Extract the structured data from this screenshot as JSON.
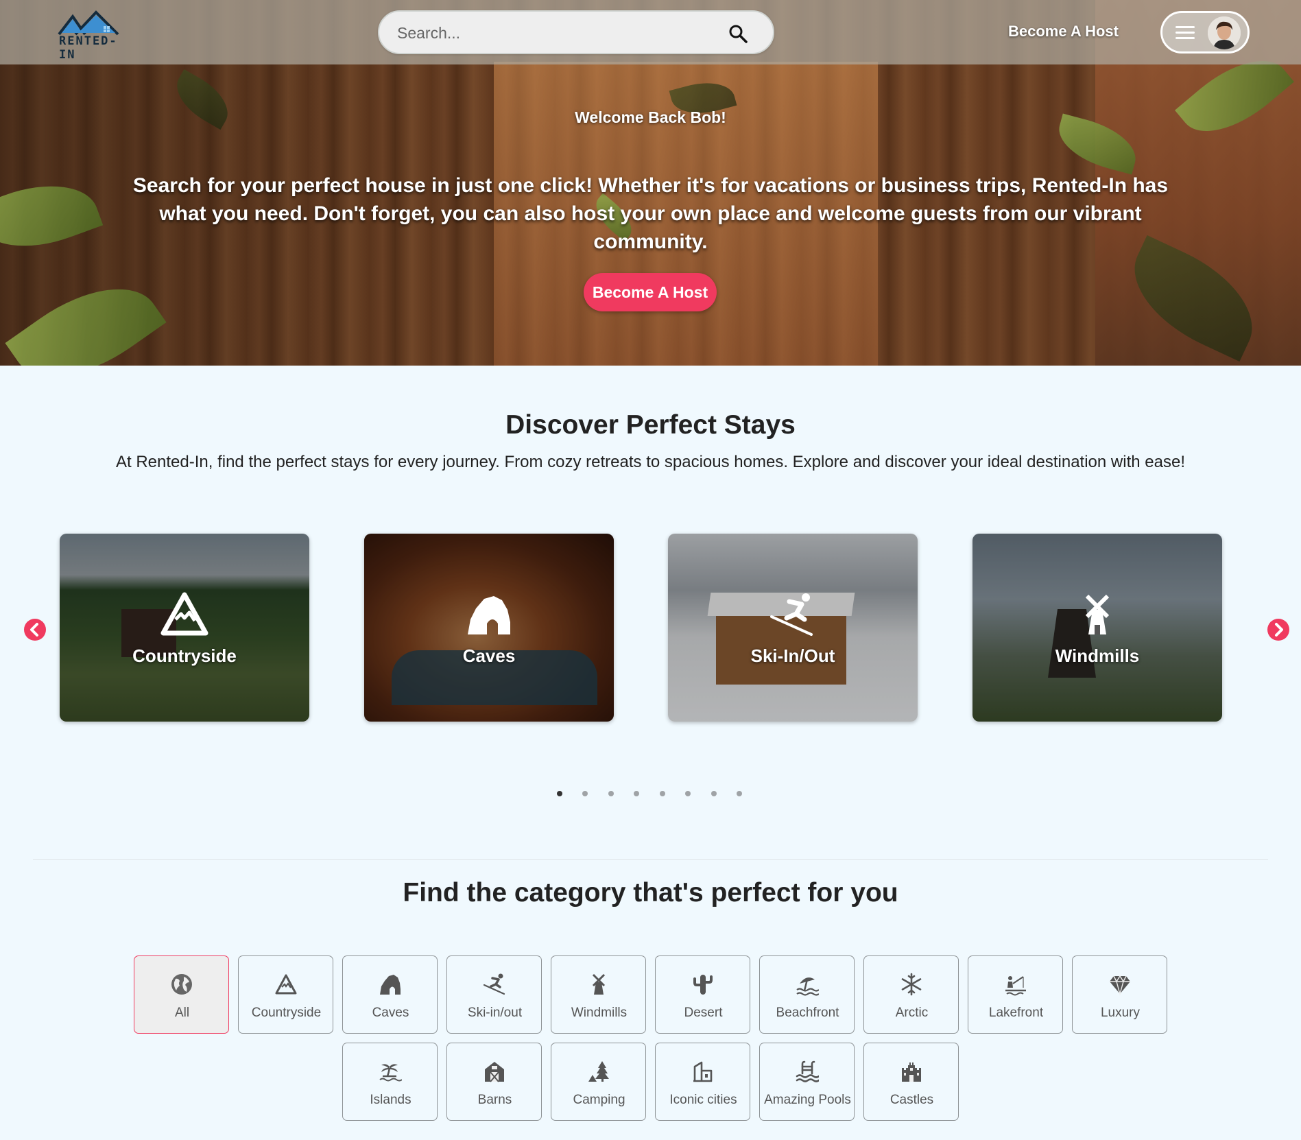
{
  "brand": {
    "logo_text": "RENTED-IN"
  },
  "header": {
    "search_placeholder": "Search...",
    "become_host_label": "Become A Host"
  },
  "hero": {
    "welcome": "Welcome Back Bob!",
    "tagline": "Search for your perfect house in just one click! Whether it's for vacations or business trips, Rented-In has what you need. Don't forget, you can also host your own place and welcome guests from our vibrant community.",
    "cta_label": "Become A Host"
  },
  "discover": {
    "title": "Discover Perfect Stays",
    "subtitle": "At Rented-In, find the perfect stays for every journey. From cozy retreats to spacious homes. Explore and discover your ideal destination with ease!",
    "cards": [
      {
        "label": "Countryside",
        "icon": "mountain-icon"
      },
      {
        "label": "Caves",
        "icon": "cave-icon"
      },
      {
        "label": "Ski-In/Out",
        "icon": "skier-icon"
      },
      {
        "label": "Windmills",
        "icon": "windmill-icon"
      }
    ],
    "dots_count": 8,
    "active_dot": 1
  },
  "categories": {
    "title": "Find the category that's perfect for you",
    "selected": "All",
    "items": [
      {
        "label": "All",
        "icon": "globe-icon"
      },
      {
        "label": "Countryside",
        "icon": "mountain-icon"
      },
      {
        "label": "Caves",
        "icon": "cave-icon"
      },
      {
        "label": "Ski-in/out",
        "icon": "skier-icon"
      },
      {
        "label": "Windmills",
        "icon": "windmill-icon"
      },
      {
        "label": "Desert",
        "icon": "cactus-icon"
      },
      {
        "label": "Beachfront",
        "icon": "beach-icon"
      },
      {
        "label": "Arctic",
        "icon": "snowflake-icon"
      },
      {
        "label": "Lakefront",
        "icon": "lake-icon"
      },
      {
        "label": "Luxury",
        "icon": "diamond-icon"
      },
      {
        "label": "Islands",
        "icon": "island-icon"
      },
      {
        "label": "Barns",
        "icon": "barn-icon"
      },
      {
        "label": "Camping",
        "icon": "camping-icon"
      },
      {
        "label": "Iconic cities",
        "icon": "city-icon"
      },
      {
        "label": "Amazing Pools",
        "icon": "pool-icon"
      },
      {
        "label": "Castles",
        "icon": "castle-icon"
      }
    ]
  },
  "colors": {
    "accent": "#f03a5f",
    "background": "#f0f9fe",
    "text": "#222222"
  }
}
